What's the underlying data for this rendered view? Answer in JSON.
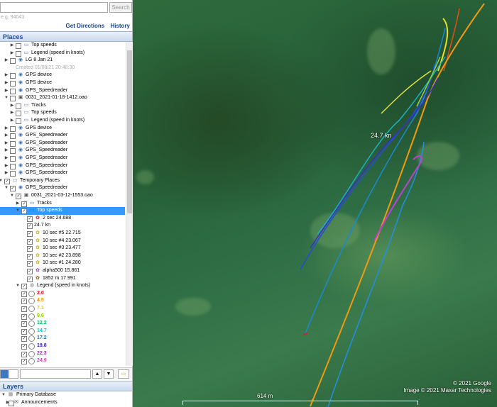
{
  "search": {
    "button": "Search",
    "hint": "e.g. 94043"
  },
  "links": {
    "directions": "Get Directions",
    "history": "History"
  },
  "places": {
    "title": "Places",
    "rows": [
      {
        "depth": 1,
        "arrow": "▶",
        "check": "",
        "icon": "folder",
        "label": "Top speeds"
      },
      {
        "depth": 1,
        "arrow": "▶",
        "check": "",
        "icon": "folder",
        "label": "Legend (speed in knots)"
      },
      {
        "depth": 0,
        "arrow": "▶",
        "check": "",
        "icon": "gps",
        "label": "LG 8 Jan 21"
      },
      {
        "depth": 1,
        "arrow": "",
        "check": "none",
        "icon": "",
        "label": "Created 01/08/21 20:48:30",
        "muted": true
      },
      {
        "depth": 0,
        "arrow": "▶",
        "check": "",
        "icon": "gps",
        "label": "GPS device"
      },
      {
        "depth": 0,
        "arrow": "▶",
        "check": "",
        "icon": "gps",
        "label": "GPS device"
      },
      {
        "depth": 0,
        "arrow": "▶",
        "check": "",
        "icon": "gps",
        "label": "GPS_Speedreader"
      },
      {
        "depth": 0,
        "arrow": "▼",
        "check": "",
        "icon": "track",
        "label": "0031_2021-01-18-1412.oao"
      },
      {
        "depth": 1,
        "arrow": "▶",
        "check": "",
        "icon": "folder",
        "label": "Tracks"
      },
      {
        "depth": 1,
        "arrow": "▶",
        "check": "",
        "icon": "folder",
        "label": "Top speeds"
      },
      {
        "depth": 1,
        "arrow": "▶",
        "check": "",
        "icon": "folder",
        "label": "Legend (speed in knots)"
      },
      {
        "depth": 0,
        "arrow": "▶",
        "check": "",
        "icon": "gps",
        "label": "GPS device"
      },
      {
        "depth": 0,
        "arrow": "▶",
        "check": "",
        "icon": "gps",
        "label": "GPS_Speedreader"
      },
      {
        "depth": 0,
        "arrow": "▶",
        "check": "",
        "icon": "gps",
        "label": "GPS_Speedreader"
      },
      {
        "depth": 0,
        "arrow": "▶",
        "check": "",
        "icon": "gps",
        "label": "GPS_Speedreader"
      },
      {
        "depth": 0,
        "arrow": "▶",
        "check": "",
        "icon": "gps",
        "label": "GPS_Speedreader"
      },
      {
        "depth": 0,
        "arrow": "▶",
        "check": "",
        "icon": "gps",
        "label": "GPS_Speedreader"
      },
      {
        "depth": 0,
        "arrow": "▶",
        "check": "",
        "icon": "gps",
        "label": "GPS_Speedreader"
      },
      {
        "depth": -1,
        "arrow": "▼",
        "check": "✓",
        "icon": "folder",
        "label": "Temporary Places"
      },
      {
        "depth": 0,
        "arrow": "▼",
        "check": "✓",
        "icon": "gps",
        "label": "GPS_Speedreader"
      },
      {
        "depth": 1,
        "arrow": "▼",
        "check": "✓",
        "icon": "track",
        "label": "0031_2021-03-12-1553.oao"
      },
      {
        "depth": 2,
        "arrow": "▶",
        "check": "✓",
        "icon": "folder",
        "label": "Tracks"
      },
      {
        "depth": 2,
        "arrow": "▼",
        "check": "✓",
        "icon": "folder",
        "label": "Top speeds",
        "selected": true
      },
      {
        "depth": 3,
        "arrow": "",
        "check": "✓",
        "icon": "pin-red",
        "label": "2 sec 24.688"
      },
      {
        "depth": 3,
        "arrow": "",
        "check": "✓",
        "icon": "",
        "label": "24.7 kn"
      },
      {
        "depth": 3,
        "arrow": "",
        "check": "✓",
        "icon": "pin-yellow",
        "label": "10 sec #5 22.715"
      },
      {
        "depth": 3,
        "arrow": "",
        "check": "✓",
        "icon": "pin-yellow",
        "label": "10 sec #4 23.067"
      },
      {
        "depth": 3,
        "arrow": "",
        "check": "✓",
        "icon": "pin-yellow",
        "label": "10 sec #3 23.477"
      },
      {
        "depth": 3,
        "arrow": "",
        "check": "✓",
        "icon": "pin-yellow",
        "label": "10 sec #2 23.898"
      },
      {
        "depth": 3,
        "arrow": "",
        "check": "✓",
        "icon": "pin-yellow",
        "label": "10 sec #1 24.280"
      },
      {
        "depth": 3,
        "arrow": "",
        "check": "✓",
        "icon": "pin-purple",
        "label": "alpha500 15.861"
      },
      {
        "depth": 3,
        "arrow": "",
        "check": "✓",
        "icon": "pin-brown",
        "label": "1852 m 17.991"
      },
      {
        "depth": 2,
        "arrow": "▼",
        "check": "✓",
        "icon": "legend",
        "label": "Legend (speed in knots)"
      }
    ],
    "legend": [
      {
        "value": "2.0",
        "color": "#e00000"
      },
      {
        "value": "4.5",
        "color": "#ff8c00"
      },
      {
        "value": "7.1",
        "color": "#e0d000"
      },
      {
        "value": "9.6",
        "color": "#8cd000"
      },
      {
        "value": "12.2",
        "color": "#00c060"
      },
      {
        "value": "14.7",
        "color": "#00d0d0"
      },
      {
        "value": "17.2",
        "color": "#1c70e0"
      },
      {
        "value": "19.8",
        "color": "#3020b0"
      },
      {
        "value": "22.3",
        "color": "#b020d0"
      },
      {
        "value": "24.9",
        "color": "#e040c0"
      }
    ]
  },
  "layers": {
    "title": "Layers",
    "items": [
      {
        "label": "Primary Database"
      },
      {
        "label": "Announcements"
      }
    ]
  },
  "map": {
    "speed_label": "24.7 kn",
    "copyright1": "© 2021 Google",
    "copyright2": "Image © 2021 Maxar Technologies",
    "scale": "614 m"
  }
}
